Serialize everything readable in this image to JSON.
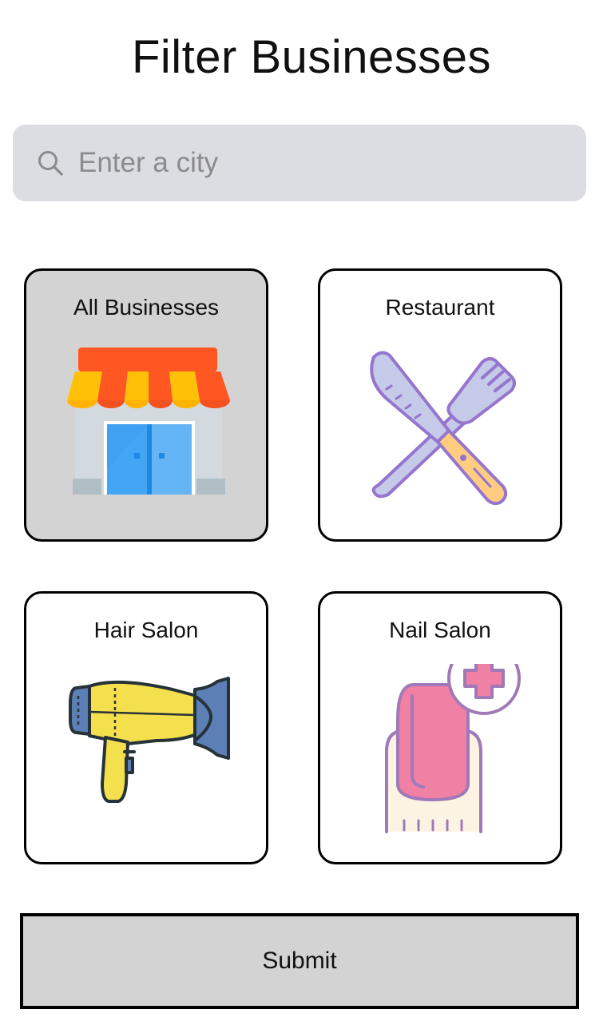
{
  "header": {
    "title": "Filter Businesses"
  },
  "search": {
    "placeholder": "Enter a city",
    "value": "",
    "icon": "search-icon"
  },
  "categories": [
    {
      "label": "All Businesses",
      "icon": "storefront-icon",
      "selected": true
    },
    {
      "label": "Restaurant",
      "icon": "knife-fork-icon",
      "selected": false
    },
    {
      "label": "Hair Salon",
      "icon": "hair-dryer-icon",
      "selected": false
    },
    {
      "label": "Nail Salon",
      "icon": "nail-plus-icon",
      "selected": false
    }
  ],
  "colors": {
    "selected_card": "#d3d3d3",
    "search_background": "#dcdde2",
    "submit_background": "#d3d3d3"
  },
  "submit": {
    "label": "Submit"
  }
}
